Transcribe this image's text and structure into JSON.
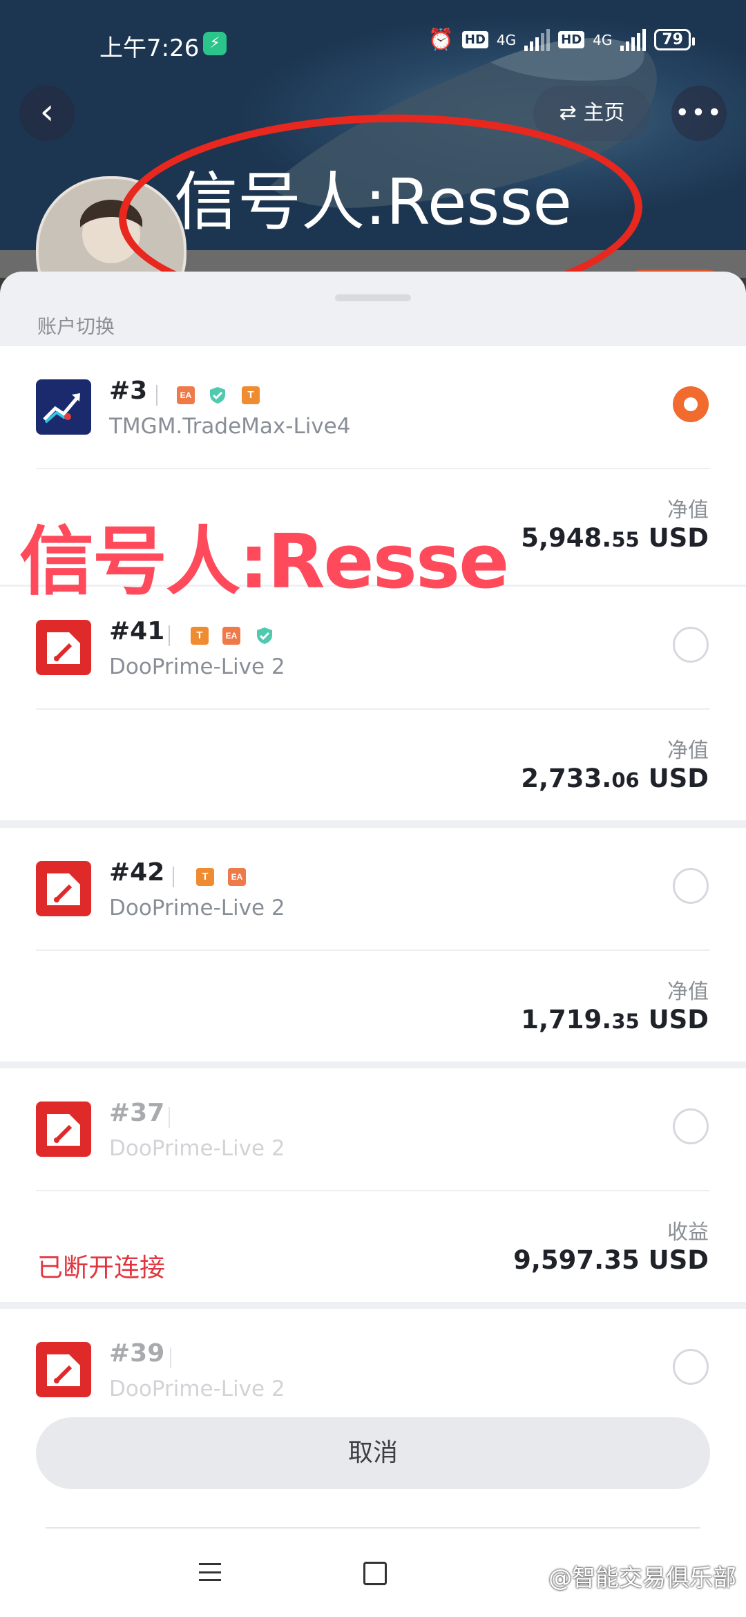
{
  "status_bar": {
    "time": "上午7:26",
    "network_1": "4G",
    "network_2": "4G",
    "hd": "HD",
    "battery": "79"
  },
  "header": {
    "back_icon": "chevron-left-icon",
    "switch_label": "主页",
    "more_icon": "more-dots-icon",
    "overlay_title": "信号人:Resse"
  },
  "sheet": {
    "title": "账户切换",
    "accounts": [
      {
        "number": "#3",
        "server": "TMGM.TradeMax-Live4",
        "value_label": "净值",
        "value_int": "5,948.",
        "value_frac": "55",
        "currency": "USD",
        "selected": true
      },
      {
        "number": "#41",
        "server": "DooPrime-Live 2",
        "value_label": "净值",
        "value_int": "2,733.",
        "value_frac": "06",
        "currency": "USD",
        "selected": false
      },
      {
        "number": "#42",
        "server": "DooPrime-Live 2",
        "value_label": "净值",
        "value_int": "1,719.",
        "value_frac": "35",
        "currency": "USD",
        "selected": false
      },
      {
        "number": "#37",
        "server": "DooPrime-Live 2",
        "value_label": "收益",
        "value_full": "9,597.35 USD",
        "status": "已断开连接",
        "selected": false
      },
      {
        "number": "#39",
        "server": "DooPrime-Live 2",
        "selected": false
      }
    ],
    "tags": {
      "ea": "EA",
      "t": "T"
    },
    "watermark": "信号人:Resse",
    "cancel_label": "取消"
  },
  "footer": {
    "source_mark": "@智能交易俱乐部"
  },
  "colors": {
    "accent": "#f16b2e",
    "danger": "#e0363f",
    "header": "#284866"
  }
}
